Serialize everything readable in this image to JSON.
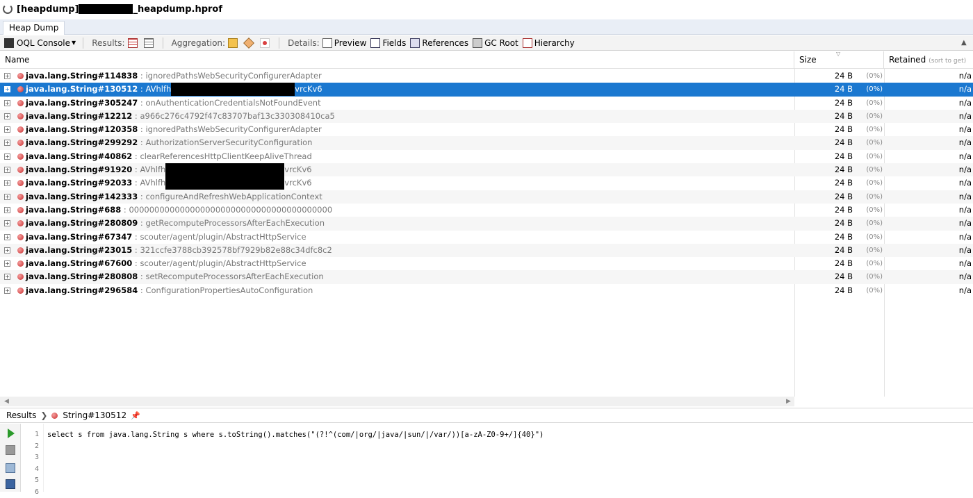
{
  "window": {
    "title_prefix": "[heapdump]",
    "title_suffix": "_heapdump.hprof"
  },
  "tab": {
    "label": "Heap Dump"
  },
  "toolbar": {
    "console_label": "OQL Console",
    "results_label": "Results:",
    "aggregation_label": "Aggregation:",
    "details_label": "Details:",
    "preview_label": "Preview",
    "fields_label": "Fields",
    "references_label": "References",
    "gcroot_label": "GC Root",
    "hierarchy_label": "Hierarchy"
  },
  "table": {
    "columns": {
      "name": "Name",
      "size": "Size",
      "retained": "Retained",
      "retained_hint": "(sort to get)"
    },
    "rows": [
      {
        "cls": "java.lang.String#114838",
        "value": "ignoredPathsWebSecurityConfigurerAdapter",
        "size": "24 B",
        "pct": "(0%)",
        "ret": "n/a"
      },
      {
        "cls": "java.lang.String#130512",
        "value_a": "AVhlfh",
        "value_b": "vrcKv6",
        "size": "24 B",
        "pct": "(0%)",
        "ret": "n/a",
        "selected": true
      },
      {
        "cls": "java.lang.String#305247",
        "value": "onAuthenticationCredentialsNotFoundEvent",
        "size": "24 B",
        "pct": "(0%)",
        "ret": "n/a"
      },
      {
        "cls": "java.lang.String#12212",
        "value": "a966c276c4792f47c83707baf13c330308410ca5",
        "size": "24 B",
        "pct": "(0%)",
        "ret": "n/a"
      },
      {
        "cls": "java.lang.String#120358",
        "value": "ignoredPathsWebSecurityConfigurerAdapter",
        "size": "24 B",
        "pct": "(0%)",
        "ret": "n/a"
      },
      {
        "cls": "java.lang.String#299292",
        "value": "AuthorizationServerSecurityConfiguration",
        "size": "24 B",
        "pct": "(0%)",
        "ret": "n/a"
      },
      {
        "cls": "java.lang.String#40862",
        "value": "clearReferencesHttpClientKeepAliveThread",
        "size": "24 B",
        "pct": "(0%)",
        "ret": "n/a"
      },
      {
        "cls": "java.lang.String#91920",
        "value_a": "AVhlfh",
        "value_b": "vrcKv6",
        "size": "24 B",
        "pct": "(0%)",
        "ret": "n/a"
      },
      {
        "cls": "java.lang.String#92033",
        "value_a": "AVhlfh",
        "value_b": "vrcKv6",
        "size": "24 B",
        "pct": "(0%)",
        "ret": "n/a"
      },
      {
        "cls": "java.lang.String#142333",
        "value": "configureAndRefreshWebApplicationContext",
        "size": "24 B",
        "pct": "(0%)",
        "ret": "n/a"
      },
      {
        "cls": "java.lang.String#688",
        "value": "0000000000000000000000000000000000000000",
        "size": "24 B",
        "pct": "(0%)",
        "ret": "n/a"
      },
      {
        "cls": "java.lang.String#280809",
        "value": "getRecomputeProcessorsAfterEachExecution",
        "size": "24 B",
        "pct": "(0%)",
        "ret": "n/a"
      },
      {
        "cls": "java.lang.String#67347",
        "value": "scouter/agent/plugin/AbstractHttpService",
        "size": "24 B",
        "pct": "(0%)",
        "ret": "n/a"
      },
      {
        "cls": "java.lang.String#23015",
        "value": "321ccfe3788cb392578bf7929b82e88c34dfc8c2",
        "size": "24 B",
        "pct": "(0%)",
        "ret": "n/a"
      },
      {
        "cls": "java.lang.String#67600",
        "value": "scouter/agent/plugin/AbstractHttpService",
        "size": "24 B",
        "pct": "(0%)",
        "ret": "n/a"
      },
      {
        "cls": "java.lang.String#280808",
        "value": "setRecomputeProcessorsAfterEachExecution",
        "size": "24 B",
        "pct": "(0%)",
        "ret": "n/a"
      },
      {
        "cls": "java.lang.String#296584",
        "value": "ConfigurationPropertiesAutoConfiguration",
        "size": "24 B",
        "pct": "(0%)",
        "ret": "n/a"
      }
    ]
  },
  "breadcrumb": {
    "root": "Results",
    "item": "String#130512"
  },
  "editor": {
    "line_numbers": [
      "1",
      "2",
      "3",
      "4",
      "5",
      "6"
    ],
    "code": "select s from java.lang.String s where s.toString().matches(\"(?!^(com/|org/|java/|sun/|/var/))[a-zA-Z0-9+/]{40}\")"
  }
}
